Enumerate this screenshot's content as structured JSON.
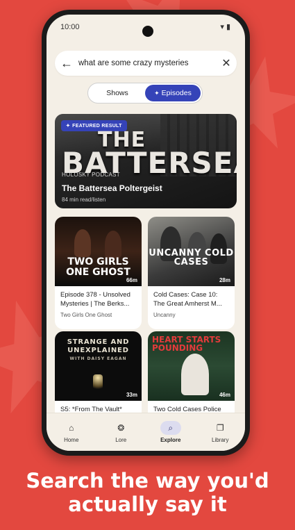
{
  "status": {
    "time": "10:00"
  },
  "search": {
    "query": "what are some crazy mysteries"
  },
  "segmented": {
    "shows": "Shows",
    "episodes": "Episodes"
  },
  "featured": {
    "badge": "FEATURED RESULT",
    "art_line1": "THE",
    "art_line2": "BATTERSEA",
    "podcast": "HOLOSKY PODCAST",
    "title": "The Battersea Poltergeist",
    "duration": "84 min read/listen"
  },
  "results": [
    {
      "art_text": "TWO GIRLS ONE GHOST",
      "duration": "66m",
      "title": "Episode 378 - Unsolved Mysteries | The Berks...",
      "show": "Two Girls One Ghost"
    },
    {
      "art_text": "UNCANNY COLD CASES",
      "duration": "28m",
      "title": "Cold Cases: Case 10: The Great Amherst M...",
      "show": "Uncanny"
    },
    {
      "art_text": "STRANGE AND UNEXPLAINED",
      "art_sub": "WITH DAISY EAGAN",
      "duration": "33m",
      "title": "S5: *From The Vault*",
      "show": ""
    },
    {
      "art_text": "HEART STARTS POUNDING",
      "duration": "46m",
      "title": "Two Cold Cases Police",
      "show": ""
    }
  ],
  "nav": [
    {
      "label": "Home",
      "icon": "home-icon"
    },
    {
      "label": "Lore",
      "icon": "brain-icon"
    },
    {
      "label": "Explore",
      "icon": "search-icon"
    },
    {
      "label": "Library",
      "icon": "library-icon"
    }
  ],
  "tagline": "Search the way you'd actually say it",
  "colors": {
    "background": "#e3483f",
    "accent": "#3543b8",
    "screen": "#f4efe6"
  }
}
